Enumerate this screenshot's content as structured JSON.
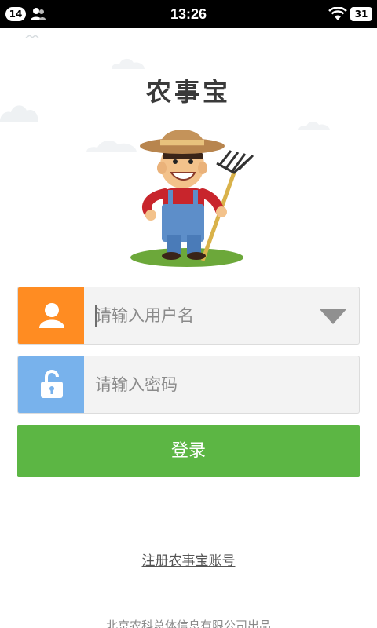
{
  "status_bar": {
    "notification_count": "14",
    "time": "13:26",
    "battery": "31",
    "icons": [
      "person-icon",
      "wifi-icon",
      "battery-icon"
    ]
  },
  "app": {
    "title": "农事宝"
  },
  "login_form": {
    "username_placeholder": "请输入用户名",
    "password_placeholder": "请输入密码",
    "login_label": "登录",
    "username_icon": "user-icon",
    "password_icon": "unlock-icon",
    "dropdown_icon": "chevron-down-icon"
  },
  "register_link": "注册农事宝账号",
  "footer": "北京农科总体信息有限公司出品",
  "colors": {
    "accent_orange": "#ff8c22",
    "accent_blue": "#78b2ec",
    "login_green": "#5cb644",
    "field_bg": "#f3f3f3"
  }
}
